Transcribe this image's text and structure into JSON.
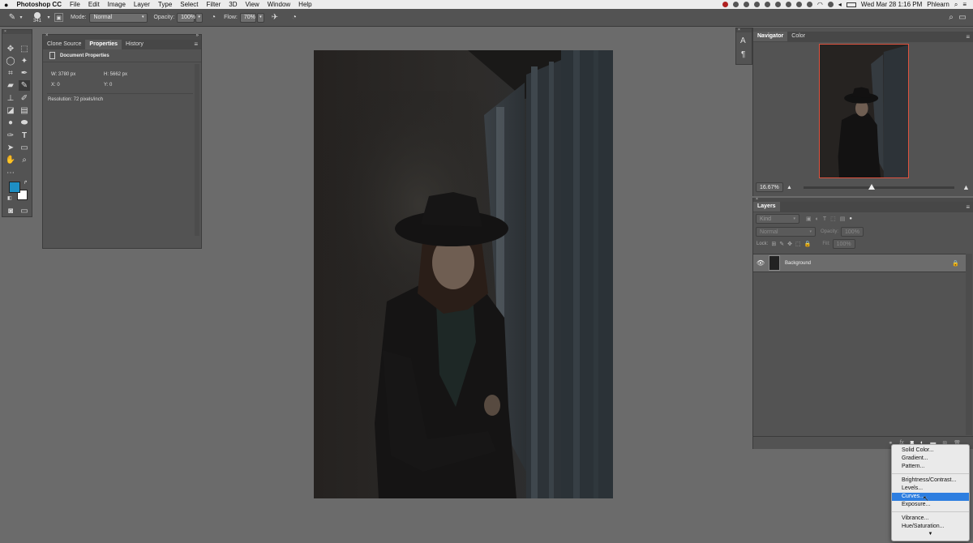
{
  "menubar": {
    "app_name": "Photoshop CC",
    "items": [
      "File",
      "Edit",
      "Image",
      "Layer",
      "Type",
      "Select",
      "Filter",
      "3D",
      "View",
      "Window",
      "Help"
    ],
    "clock": "Wed Mar 28  1:16 PM",
    "user": "Phlearn"
  },
  "options_bar": {
    "brush_size": "341",
    "mode_label": "Mode:",
    "mode_value": "Normal",
    "opacity_label": "Opacity:",
    "opacity_value": "100%",
    "flow_label": "Flow:",
    "flow_value": "70%"
  },
  "properties_panel": {
    "tabs": [
      "Clone Source",
      "Properties",
      "History"
    ],
    "active_tab": "Properties",
    "header": "Document Properties",
    "width": "W: 3780 px",
    "height": "H: 5662 px",
    "x": "X: 0",
    "y": "Y: 0",
    "resolution": "Resolution: 72 pixels/inch"
  },
  "navigator_panel": {
    "tabs": [
      "Navigator",
      "Color"
    ],
    "zoom": "16.67%",
    "zoom_fraction": 0.45
  },
  "layers_panel": {
    "title": "Layers",
    "kind_placeholder": "Kind",
    "blend_mode": "Normal",
    "opacity_label": "Opacity:",
    "opacity_value": "100%",
    "lock_label": "Lock:",
    "fill_label": "Fill:",
    "fill_value": "100%",
    "layers": [
      {
        "name": "Background",
        "visible": true,
        "locked": true
      }
    ]
  },
  "adjustment_menu": {
    "items": [
      "Solid Color...",
      "Gradient...",
      "Pattern...",
      "Brightness/Contrast...",
      "Levels...",
      "Curves...",
      "Exposure...",
      "Vibrance...",
      "Hue/Saturation..."
    ],
    "highlighted": "Curves...",
    "more_indicator": "▼"
  },
  "side_strip": {
    "char_icon": "A",
    "para_icon": "¶"
  },
  "colors": {
    "foreground": "#1e8fc4",
    "background": "#ffffff",
    "highlight": "#2d7ee0",
    "navigator_frame": "#e0533f"
  }
}
